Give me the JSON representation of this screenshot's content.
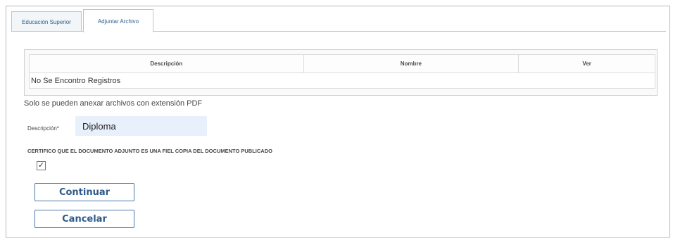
{
  "tabs": [
    {
      "label": "Educación Superior",
      "active": false
    },
    {
      "label": "Adjuntar Archivo",
      "active": true
    }
  ],
  "table": {
    "headers": [
      "Descripción",
      "Nombre",
      "Ver"
    ],
    "empty_message": "No Se Encontro Registros"
  },
  "note": "Solo se pueden anexar archivos con extensión PDF",
  "descripcion": {
    "label": "Descripción*",
    "value": "Diploma"
  },
  "certify": {
    "label": "CERTIFICO QUE EL DOCUMENTO ADJUNTO ES UNA FIEL COPIA DEL DOCUMENTO PUBLICADO",
    "checked": true,
    "check_glyph": "✓"
  },
  "buttons": {
    "continue_label": "Continuar",
    "cancel_label": "Cancelar"
  }
}
